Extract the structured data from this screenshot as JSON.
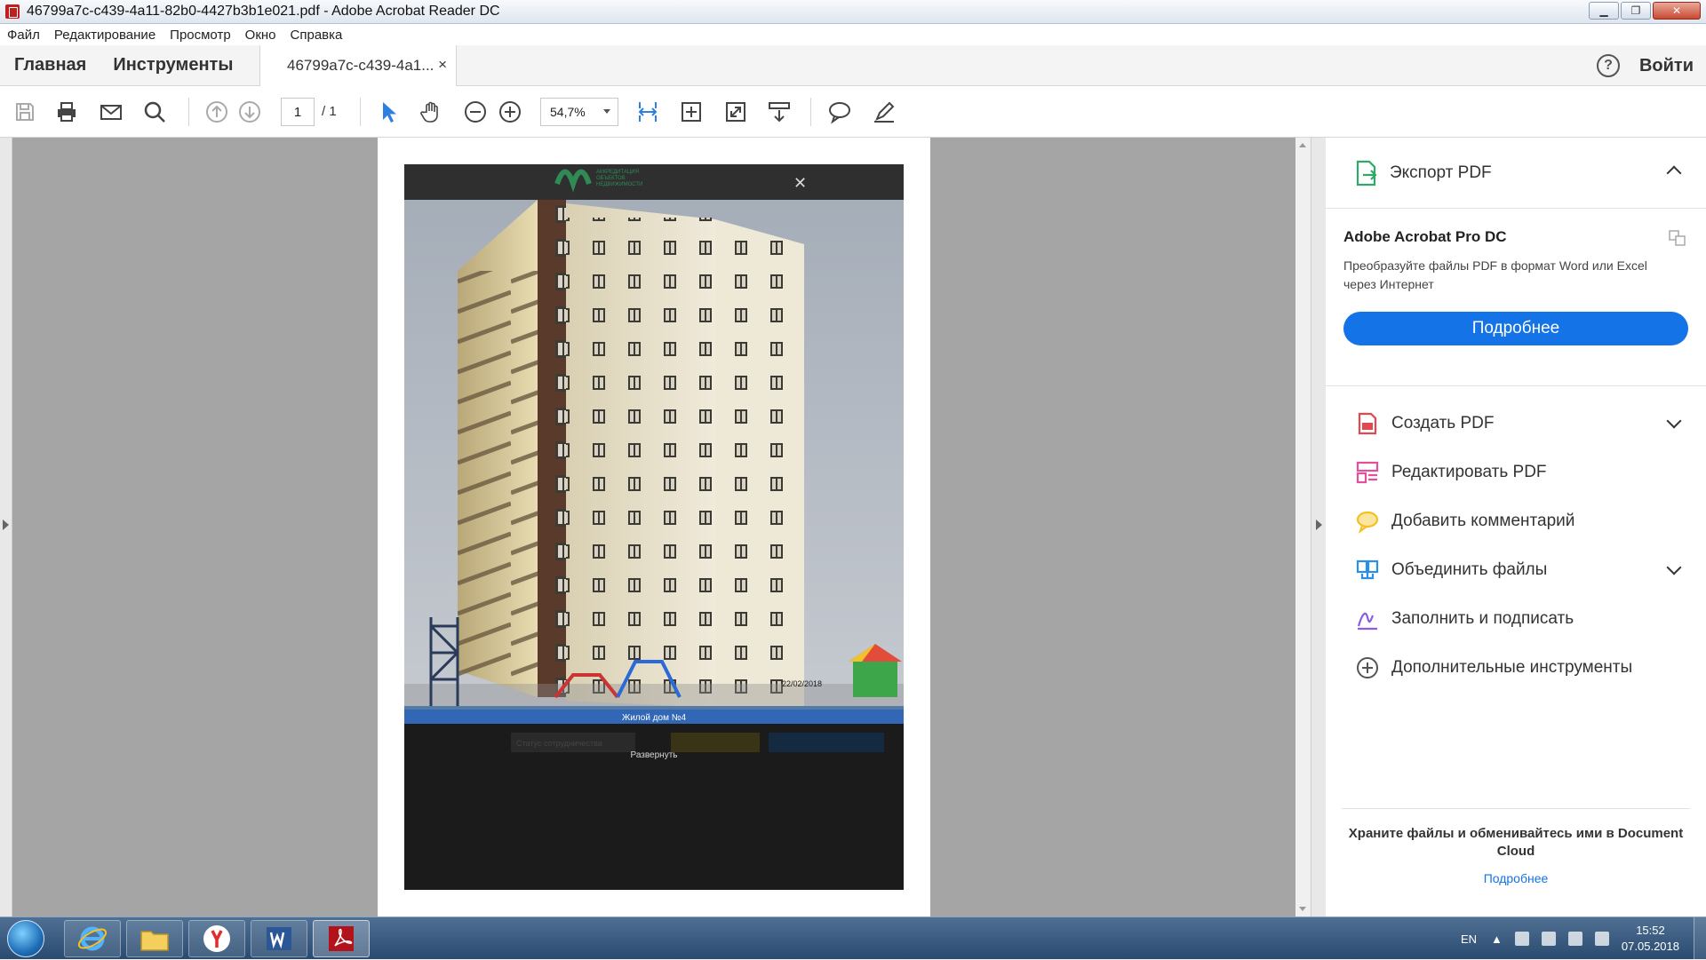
{
  "window": {
    "title": "46799a7c-c439-4a11-82b0-4427b3b1e021.pdf - Adobe Acrobat Reader DC"
  },
  "menu": [
    "Файл",
    "Редактирование",
    "Просмотр",
    "Окно",
    "Справка"
  ],
  "nav": {
    "home": "Главная",
    "tools": "Инструменты",
    "doc_tab": "46799a7c-c439-4a1...",
    "close": "×",
    "help": "?",
    "signin": "Войти"
  },
  "toolbar": {
    "page_current": "1",
    "page_total": "/ 1",
    "zoom": "54,7%"
  },
  "photo": {
    "caption": "Жилой дом №4",
    "date_stamp": "22/02/2018",
    "expand": "Развернуть",
    "status_label": "Статус сотрудничества",
    "close": "✕",
    "logo_text": "АККРЕДИТАЦИЯ ОБЪЕКТОВ НЕДВИЖИМОСТИ"
  },
  "panel": {
    "export_label": "Экспорт PDF",
    "pro_title": "Adobe Acrobat Pro DC",
    "pro_desc": "Преобразуйте файлы PDF в формат Word или Excel через Интернет",
    "pro_button": "Подробнее",
    "tools": [
      {
        "label": "Создать PDF",
        "icon": "create-pdf-icon",
        "color": "#e34850"
      },
      {
        "label": "Редактировать PDF",
        "icon": "edit-pdf-icon",
        "color": "#e34f9b"
      },
      {
        "label": "Добавить комментарий",
        "icon": "comment-icon",
        "color": "#f5c024"
      },
      {
        "label": "Объединить файлы",
        "icon": "combine-files-icon",
        "color": "#2d8ee6"
      },
      {
        "label": "Заполнить и подписать",
        "icon": "fill-sign-icon",
        "color": "#8a5be6"
      },
      {
        "label": "Дополнительные инструменты",
        "icon": "more-tools-icon",
        "color": "#555555"
      }
    ],
    "footer_text": "Храните файлы и обменивайтесь ими в Document Cloud",
    "footer_link": "Подробнее"
  },
  "taskbar": {
    "lang": "EN",
    "time": "15:52",
    "date": "07.05.2018"
  },
  "colors": {
    "accent": "#1473e6",
    "export_green": "#2ea96b"
  }
}
